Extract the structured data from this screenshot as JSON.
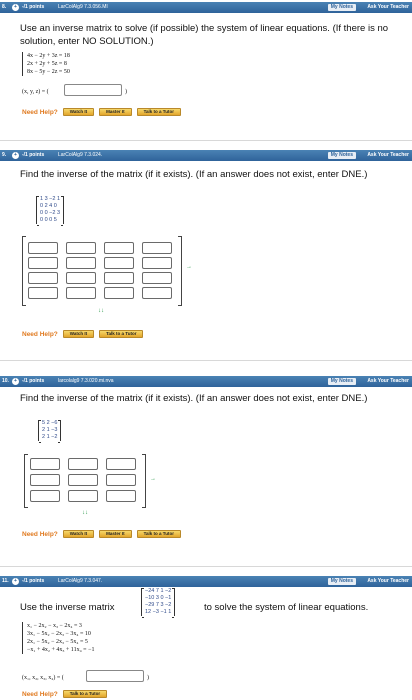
{
  "problems": [
    {
      "number": "8.",
      "points": "-/1 points",
      "code": "LarColAlg9 7.3.056.MI",
      "my_notes": "My Notes",
      "ask": "Ask Your Teacher",
      "question": "Use an inverse matrix to solve (if possible) the system of linear equations. (If there is no solution, enter NO SOLUTION.)",
      "equations": [
        "4x − 2y + 3z = 18",
        "2x + 2y + 5z = 8",
        "8x − 5y − 2z = 50"
      ],
      "answer_label": "(x, y, z) = (",
      "answer_close": ")",
      "need_help": "Need Help?",
      "buttons": [
        "Watch It",
        "Master It",
        "Talk to a Tutor"
      ]
    },
    {
      "number": "9.",
      "points": "-/1 points",
      "code": "LarColAlg9 7.3.024.",
      "my_notes": "My Notes",
      "ask": "Ask Your Teacher",
      "question": "Find the inverse of the matrix (if it exists). (If an answer does not exist, enter DNE.)",
      "matrix_rows": [
        "1  3  −2  1",
        "0  2   4  0",
        "0  0  −2  3",
        "0  0   0  5"
      ],
      "need_help": "Need Help?",
      "buttons": [
        "Watch It",
        "Talk to a Tutor"
      ]
    },
    {
      "number": "10.",
      "points": "-/1 points",
      "code": "larcolalg9 7.3.020.mi.nva",
      "my_notes": "My Notes",
      "ask": "Ask Your Teacher",
      "question": "Find the inverse of the matrix (if it exists). (If an answer does not exist, enter DNE.)",
      "matrix_rows": [
        "5  2  −6",
        "2  1  −3",
        "2  1  −2"
      ],
      "need_help": "Need Help?",
      "buttons": [
        "Watch It",
        "Master It",
        "Talk to a Tutor"
      ]
    },
    {
      "number": "11.",
      "points": "-/1 points",
      "code": "LarColAlg9 7.3.047.",
      "my_notes": "My Notes",
      "ask": "Ask Your Teacher",
      "question_left": "Use the inverse matrix",
      "question_right": "to solve the system of linear equations.",
      "matrix_rows": [
        "−24  7   1  −2",
        "−10  3   0  −1",
        "−29  7   3  −2",
        " 12 −3  −1   1"
      ],
      "equations": [
        "x₁ − 2x₂ − x₃ − 2x₄ = 3",
        "3x₁ − 5x₂ − 2x₃ − 3x₄ = 10",
        "2x₁ − 5x₂ − 2x₃ − 5x₄ = 5",
        "−x₁ + 4x₂ + 4x₃ + 11x₄ = −1"
      ],
      "answer_label": "(x₁, x₂, x₃, x₄) = (",
      "answer_close": ")",
      "need_help": "Need Help?",
      "buttons": [
        "Talk to a Tutor"
      ]
    }
  ],
  "hints": [
    "→",
    "↓↓"
  ]
}
